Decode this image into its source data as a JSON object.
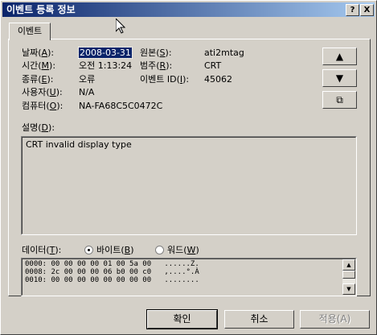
{
  "window": {
    "title": "이벤트 등록 정보",
    "help_btn": "?",
    "close_btn": "X"
  },
  "tab": {
    "label": "이벤트"
  },
  "fields": {
    "date": {
      "label": "날짜(",
      "key": "A",
      "suffix": "):",
      "value": "2008-03-31"
    },
    "time": {
      "label": "시간(",
      "key": "M",
      "suffix": "):",
      "value": "오전 1:13:24"
    },
    "type": {
      "label": "종류(",
      "key": "E",
      "suffix": "):",
      "value": "오류"
    },
    "user": {
      "label": "사용자(",
      "key": "U",
      "suffix": "):",
      "value": "N/A"
    },
    "computer": {
      "label": "컴퓨터(",
      "key": "O",
      "suffix": "):",
      "value": "NA-FA68C5C0472C"
    },
    "source": {
      "label": "원본(",
      "key": "S",
      "suffix": "):",
      "value": "ati2mtag"
    },
    "category": {
      "label": "범주(",
      "key": "R",
      "suffix": "):",
      "value": "CRT"
    },
    "event_id": {
      "label": "이벤트 ID(",
      "key": "I",
      "suffix": "):",
      "value": "45062"
    }
  },
  "description": {
    "label": "설명(",
    "key": "D",
    "suffix": "):",
    "text": "CRT invalid display type"
  },
  "data_section": {
    "label": "데이터(",
    "key": "T",
    "suffix": "):",
    "bytes_option": {
      "label": "바이트(",
      "key": "B",
      "suffix": ")",
      "selected": true
    },
    "words_option": {
      "label": "워드(",
      "key": "W",
      "suffix": ")",
      "selected": false
    },
    "lines": [
      "0000: 00 00 00 00 01 00 5a 00   ......Z.",
      "0008: 2c 00 00 00 06 b0 00 c0   ,....°.À",
      "0010: 00 00 00 00 00 00 00 00   ........"
    ]
  },
  "side_buttons": {
    "up": "▲",
    "down": "▼",
    "copy": "⧉"
  },
  "buttons": {
    "ok": "확인",
    "cancel": "취소",
    "apply": "적용(A)"
  },
  "colors": {
    "titlebar_start": "#0a246a",
    "titlebar_end": "#a6caf0",
    "face": "#d4d0c8",
    "selection": "#0a246a"
  }
}
